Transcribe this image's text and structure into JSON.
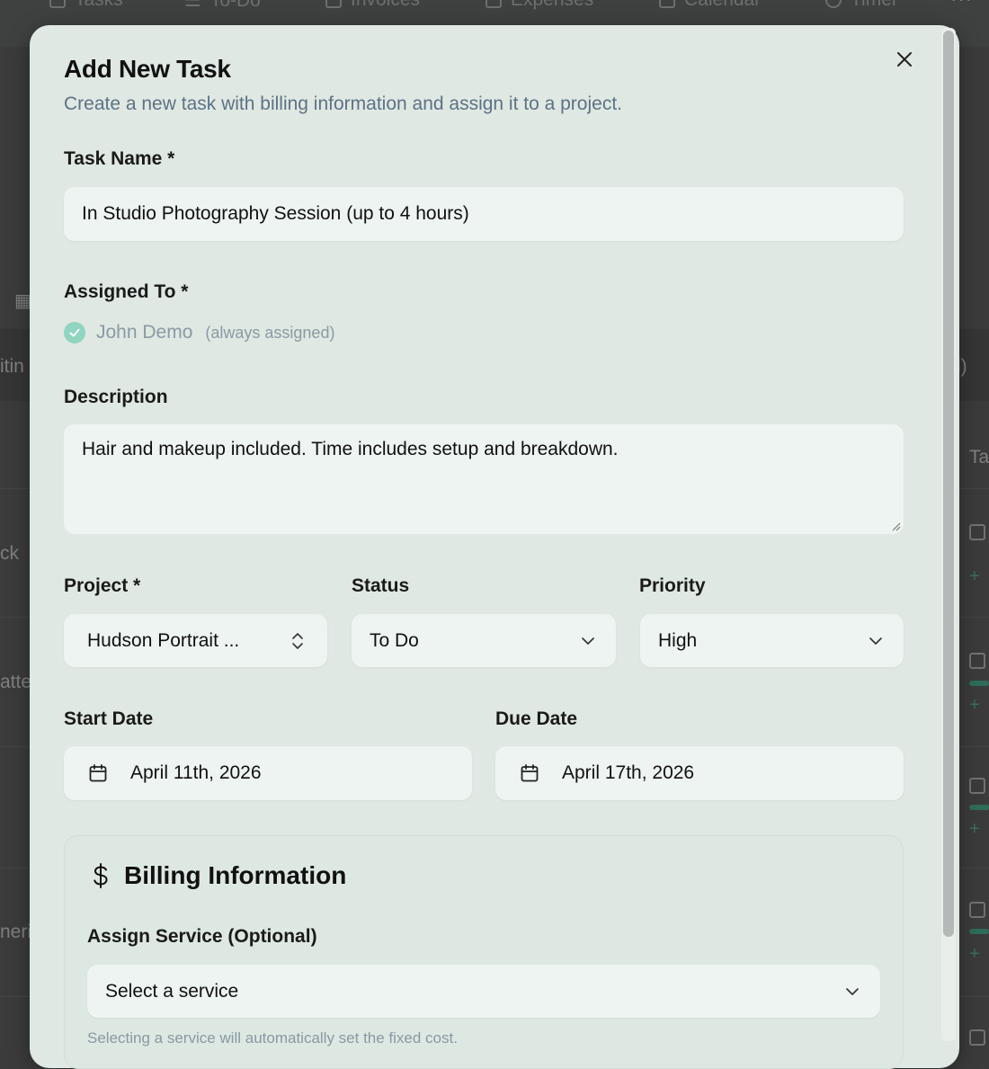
{
  "background": {
    "nav_items": [
      "Tasks",
      "To-Do",
      "Invoices",
      "Expenses",
      "Calendar",
      "Timer"
    ],
    "menu_icon": "more-dots-icon",
    "fragments": {
      "left": [
        "itin",
        "ck",
        "atte",
        "neri"
      ],
      "right": [
        "l)",
        "Ta"
      ]
    }
  },
  "dialog": {
    "title": "Add New Task",
    "subtitle": "Create a new task with billing information and assign it to a project.",
    "close_icon": "close-icon"
  },
  "form": {
    "task_name": {
      "label": "Task Name *",
      "value": "In Studio Photography Session (up to 4 hours)"
    },
    "assigned_to": {
      "label": "Assigned To *",
      "name": "John Demo",
      "note": "(always assigned)"
    },
    "description": {
      "label": "Description",
      "value": "Hair and makeup included. Time includes setup and breakdown."
    },
    "project": {
      "label": "Project *",
      "value": "Hudson Portrait ..."
    },
    "status": {
      "label": "Status",
      "value": "To Do"
    },
    "priority": {
      "label": "Priority",
      "value": "High"
    },
    "start_date": {
      "label": "Start Date",
      "value": "April 11th, 2026"
    },
    "due_date": {
      "label": "Due Date",
      "value": "April 17th, 2026"
    }
  },
  "billing": {
    "title": "Billing Information",
    "icon": "dollar-icon",
    "service_label": "Assign Service (Optional)",
    "service_placeholder": "Select a service",
    "hint": "Selecting a service will automatically set the fixed cost."
  },
  "colors": {
    "modal_bg": "#dfe8e2",
    "field_bg": "#eef4f1",
    "subtitle": "#5d7286",
    "check_accent": "#8fd5c0"
  }
}
